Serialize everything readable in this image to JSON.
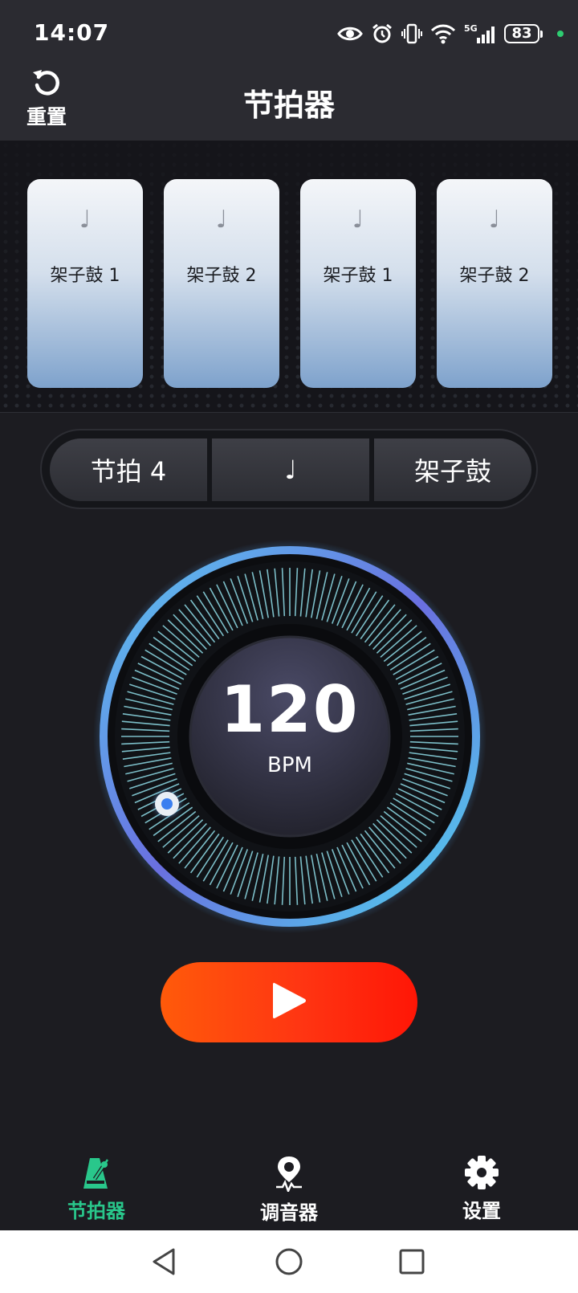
{
  "status_bar": {
    "time": "14:07",
    "icons": [
      "eye-icon",
      "alarm-icon",
      "vibrate-icon",
      "wifi-icon",
      "signal-5g-icon"
    ],
    "network": "5G",
    "battery": "83"
  },
  "header": {
    "reset_label": "重置",
    "title": "节拍器"
  },
  "beats": [
    {
      "note": "♩",
      "label": "架子鼓 1"
    },
    {
      "note": "♩",
      "label": "架子鼓 2"
    },
    {
      "note": "♩",
      "label": "架子鼓 1"
    },
    {
      "note": "♩",
      "label": "架子鼓 2"
    }
  ],
  "settings": {
    "beats_label": "节拍 4",
    "note_value": "♩",
    "sound": "架子鼓"
  },
  "tempo": {
    "value": "120",
    "unit": "BPM"
  },
  "bottom_nav": [
    {
      "label": "节拍器",
      "icon": "metronome-icon",
      "active": true
    },
    {
      "label": "调音器",
      "icon": "tuner-icon",
      "active": false
    },
    {
      "label": "设置",
      "icon": "gear-icon",
      "active": false
    }
  ],
  "colors": {
    "accent_green": "#29c78b",
    "play_start": "#ff5a0a",
    "play_end": "#ff1606",
    "ring_cyan": "#4fd6ee",
    "ring_purple": "#7b5fd8"
  }
}
